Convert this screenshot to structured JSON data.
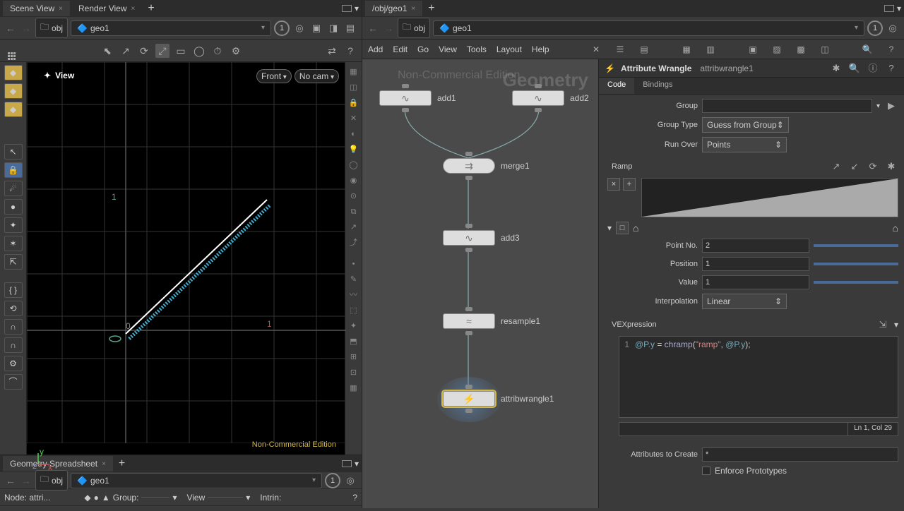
{
  "left": {
    "tabs": {
      "scene": "Scene View",
      "render": "Render View"
    },
    "path": {
      "obj": "obj",
      "geo": "geo1",
      "badge": "1"
    },
    "view": {
      "label": "View",
      "camera_front": "Front",
      "camera_nocam": "No cam",
      "nc": "Non-Commercial Edition"
    },
    "spreadsheet": {
      "tab": "Geometry Spreadsheet",
      "obj": "obj",
      "geo": "geo1",
      "badge": "1",
      "node": "Node: attri...",
      "group": "Group:",
      "view": "View",
      "intrin": "Intrin:"
    }
  },
  "right": {
    "tab": "/obj/geo1",
    "path": {
      "obj": "obj",
      "geo": "geo1",
      "badge": "1"
    },
    "menu": [
      "Add",
      "Edit",
      "Go",
      "View",
      "Tools",
      "Layout",
      "Help"
    ],
    "network": {
      "watermark": "Geometry",
      "nc": "Non-Commercial Edition",
      "nodes": {
        "add1": "add1",
        "add2": "add2",
        "merge1": "merge1",
        "add3": "add3",
        "resample1": "resample1",
        "attribwrangle1": "attribwrangle1"
      }
    },
    "params": {
      "type": "Attribute Wrangle",
      "name": "attribwrangle1",
      "tabs": {
        "code": "Code",
        "bindings": "Bindings"
      },
      "group": "Group",
      "group_type": "Group Type",
      "group_type_val": "Guess from Group",
      "run_over": "Run Over",
      "run_over_val": "Points",
      "ramp": "Ramp",
      "point_no": "Point No.",
      "point_no_val": "2",
      "position": "Position",
      "position_val": "1",
      "value": "Value",
      "value_val": "1",
      "interp": "Interpolation",
      "interp_val": "Linear",
      "vex_label": "VEXpression",
      "vex_lineno": "1",
      "vex_code": "@P.y = chramp(\"ramp\", @P.y);",
      "status": "Ln 1, Col 29",
      "attrs_create": "Attributes to Create",
      "attrs_create_val": "*",
      "enforce": "Enforce Prototypes"
    }
  }
}
